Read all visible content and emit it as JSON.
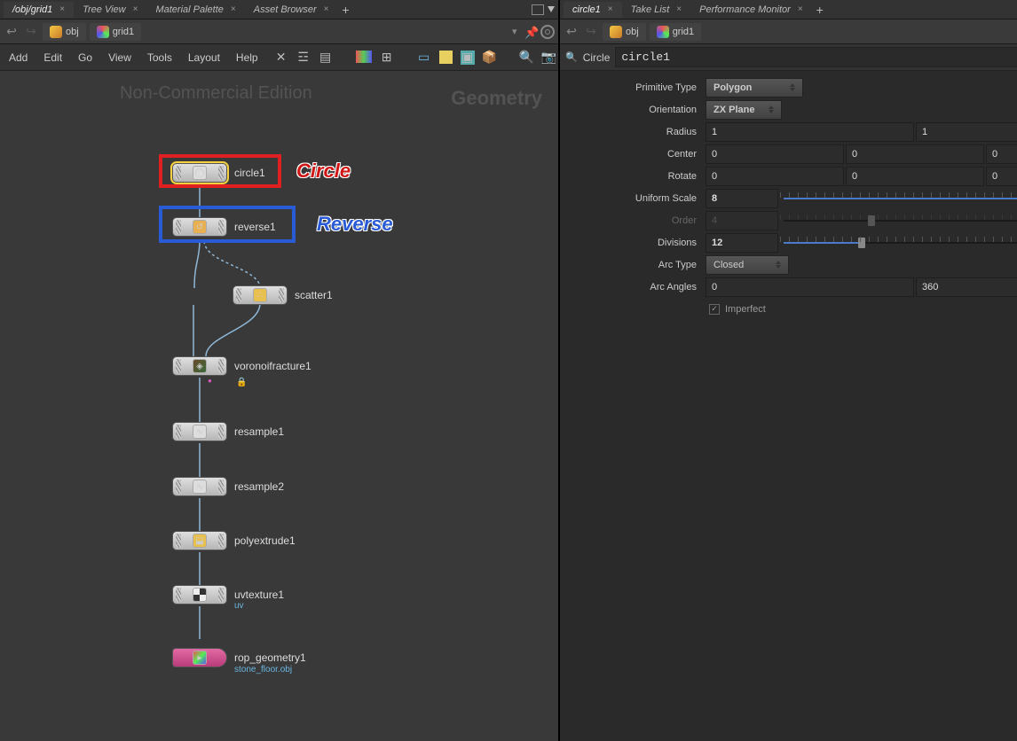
{
  "left_pane": {
    "tabs": [
      {
        "label": "/obj/grid1",
        "active": true
      },
      {
        "label": "Tree View",
        "active": false
      },
      {
        "label": "Material Palette",
        "active": false
      },
      {
        "label": "Asset Browser",
        "active": false
      }
    ],
    "path": {
      "seg1": "obj",
      "seg2": "grid1"
    },
    "menu": [
      "Add",
      "Edit",
      "Go",
      "View",
      "Tools",
      "Layout",
      "Help"
    ],
    "watermark": "Non-Commercial Edition",
    "context": "Geometry",
    "annotations": {
      "circle": "Circle",
      "reverse": "Reverse"
    },
    "nodes": {
      "circle1": "circle1",
      "reverse1": "reverse1",
      "scatter1": "scatter1",
      "voronoi": "voronoifracture1",
      "resample1": "resample1",
      "resample2": "resample2",
      "polyextrude": "polyextrude1",
      "uvtexture": "uvtexture1",
      "uvtexture_sub": "uv",
      "rop": "rop_geometry1",
      "rop_sub": "stone_floor.obj"
    }
  },
  "right_pane": {
    "tabs": [
      {
        "label": "circle1",
        "active": true
      },
      {
        "label": "Take List",
        "active": false
      },
      {
        "label": "Performance Monitor",
        "active": false
      }
    ],
    "path": {
      "seg1": "obj",
      "seg2": "grid1"
    },
    "node_type": "Circle",
    "node_name": "circle1",
    "params": {
      "labels": {
        "primtype": "Primitive Type",
        "orient": "Orientation",
        "radius": "Radius",
        "center": "Center",
        "rotate": "Rotate",
        "scale": "Uniform Scale",
        "order": "Order",
        "divs": "Divisions",
        "arctype": "Arc Type",
        "arcangles": "Arc Angles",
        "imperfect": "Imperfect"
      },
      "primtype": "Polygon",
      "orient": "ZX Plane",
      "radius": [
        "1",
        "1"
      ],
      "center": [
        "0",
        "0",
        "0"
      ],
      "rotate": [
        "0",
        "0",
        "0"
      ],
      "scale": "8",
      "order": "4",
      "divs": "12",
      "arctype": "Closed",
      "arcangles": [
        "0",
        "360"
      ]
    }
  }
}
